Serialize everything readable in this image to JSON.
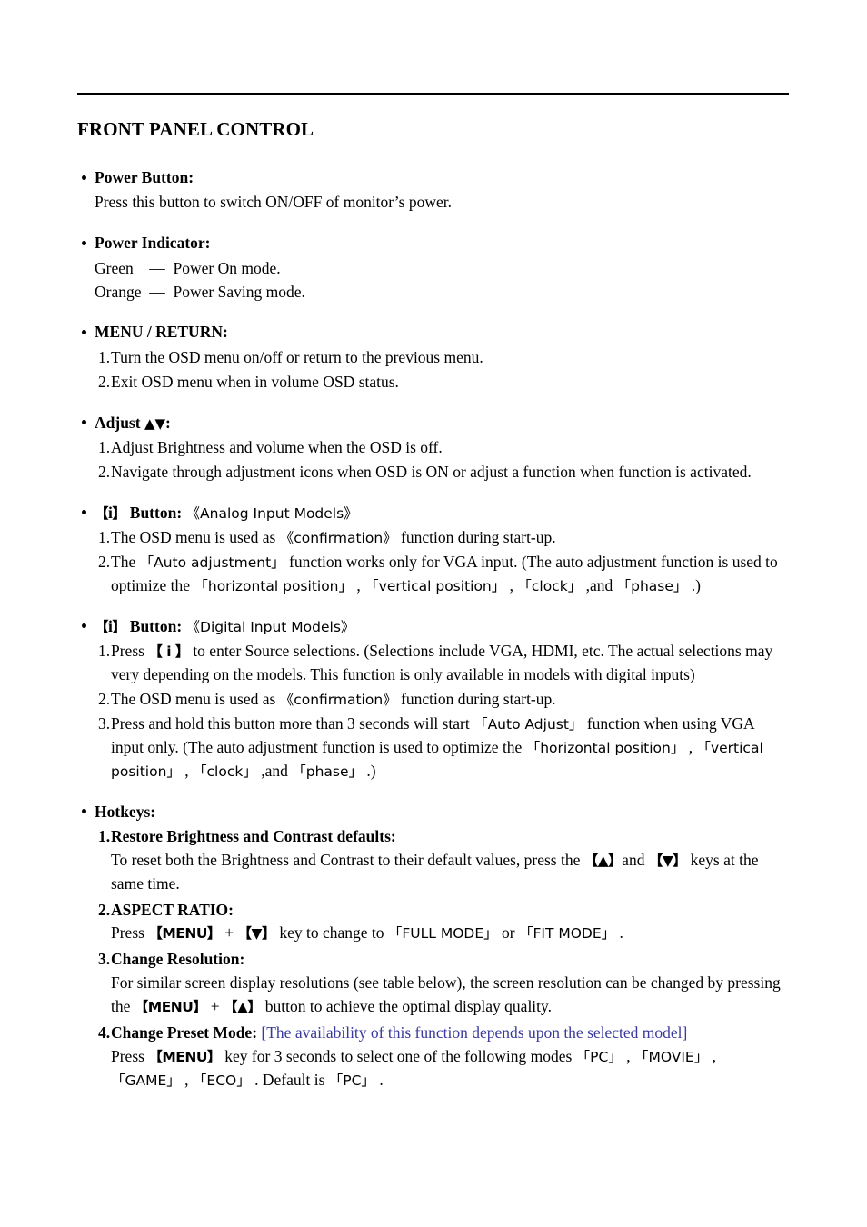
{
  "document": {
    "title": "FRONT PANEL CONTROL"
  },
  "sections": {
    "power_button": {
      "heading": "Power Button:",
      "body": "Press this button to switch ON/OFF of monitor’s power."
    },
    "power_indicator": {
      "heading": "Power Indicator:",
      "rows": [
        "Green    —  Power On mode.",
        "Orange  —  Power Saving mode."
      ]
    },
    "menu_return": {
      "heading": "MENU / RETURN:",
      "items": [
        {
          "num": "1.",
          "text": "Turn the OSD menu on/off or return to the previous menu."
        },
        {
          "num": "2.",
          "text": "Exit OSD menu when in volume OSD status."
        }
      ]
    },
    "adjust": {
      "heading_label": "Adjust",
      "heading_up": "▲",
      "heading_down": "▼",
      "heading_colon": ":",
      "items": [
        {
          "num": "1.",
          "text": "Adjust Brightness and volume when the OSD is off."
        },
        {
          "num": "2.",
          "text": "Navigate through adjustment icons when OSD is ON or adjust a function when function is activated."
        }
      ]
    },
    "i_button_analog": {
      "bracket_open": "【",
      "bracket_letter": "i",
      "bracket_close": "】",
      "heading": "Button:",
      "models": "《Analog Input Models》",
      "items": [
        {
          "num": "1.",
          "parts": [
            {
              "t": "The OSD menu is used as "
            },
            {
              "t": "《confirmation》",
              "cjk": true
            },
            {
              "t": " function during start-up."
            }
          ]
        },
        {
          "num": "2.",
          "parts": [
            {
              "t": "The "
            },
            {
              "t": "「Auto adjustment」",
              "cjk": true
            },
            {
              "t": " function works only for VGA input. (The auto adjustment function is used to optimize the "
            },
            {
              "t": "「horizontal position」",
              "cjk": true
            },
            {
              "t": " , "
            },
            {
              "t": "「vertical position」",
              "cjk": true
            },
            {
              "t": " , "
            },
            {
              "t": "「clock」",
              "cjk": true
            },
            {
              "t": " ,and "
            },
            {
              "t": "「phase」",
              "cjk": true
            },
            {
              "t": " .)"
            }
          ]
        }
      ]
    },
    "i_button_digital": {
      "bracket_open": "【",
      "bracket_letter": "i",
      "bracket_close": "】",
      "heading": "Button:",
      "models": "《Digital Input Models》",
      "items": [
        {
          "num": "1.",
          "parts": [
            {
              "t": "Press "
            },
            {
              "t": "【 i 】",
              "key": true
            },
            {
              "t": " to enter Source selections. (Selections include VGA, HDMI, etc. The actual selections may very depending on the models. This function is only available in models with digital inputs)"
            }
          ]
        },
        {
          "num": "2.",
          "parts": [
            {
              "t": "The OSD menu is used as "
            },
            {
              "t": "《confirmation》",
              "cjk": true
            },
            {
              "t": " function during start-up."
            }
          ]
        },
        {
          "num": "3.",
          "parts": [
            {
              "t": "Press and hold this button more than 3 seconds will start "
            },
            {
              "t": "「Auto Adjust」",
              "cjk": true
            },
            {
              "t": " function when using VGA input only. (The auto adjustment function is used to optimize the "
            },
            {
              "t": "「horizontal position」",
              "cjk": true
            },
            {
              "t": " , "
            },
            {
              "t": "「vertical position」",
              "cjk": true
            },
            {
              "t": " , "
            },
            {
              "t": "「clock」",
              "cjk": true
            },
            {
              "t": " ,and "
            },
            {
              "t": "「phase」",
              "cjk": true
            },
            {
              "t": " .)"
            }
          ]
        }
      ]
    },
    "hotkeys": {
      "heading": "Hotkeys:",
      "items": [
        {
          "num": "1.",
          "title": "Restore Brightness and Contrast defaults:",
          "note": "",
          "parts": [
            {
              "t": "To reset both the Brightness and Contrast to their default values, press the "
            },
            {
              "t": "【▲】",
              "key": true
            },
            {
              "t": "and "
            },
            {
              "t": "【▼】",
              "key": true
            },
            {
              "t": " keys at the same time."
            }
          ]
        },
        {
          "num": "2.",
          "title": "ASPECT RATIO:",
          "note": "",
          "parts": [
            {
              "t": "Press "
            },
            {
              "t": "【MENU】",
              "key": true
            },
            {
              "t": " + "
            },
            {
              "t": "【▼】",
              "key": true
            },
            {
              "t": " key to change to "
            },
            {
              "t": "「FULL MODE」",
              "cjk": true
            },
            {
              "t": " or "
            },
            {
              "t": "「FIT MODE」",
              "cjk": true
            },
            {
              "t": " ."
            }
          ]
        },
        {
          "num": "3.",
          "title": "Change Resolution:",
          "note": "",
          "parts": [
            {
              "t": "For similar screen display resolutions (see table below), the screen resolution can be changed by pressing the "
            },
            {
              "t": "【MENU】",
              "key": true
            },
            {
              "t": " + "
            },
            {
              "t": "【▲】",
              "key": true
            },
            {
              "t": " button to achieve the optimal display quality."
            }
          ]
        },
        {
          "num": "4.",
          "title": "Change Preset Mode:",
          "note": "[The availability of this function depends upon the selected model]",
          "parts": [
            {
              "t": "Press "
            },
            {
              "t": "【MENU】",
              "key": true
            },
            {
              "t": " key for 3 seconds to select one of the following modes "
            },
            {
              "t": "「PC」",
              "cjk": true
            },
            {
              "t": " , "
            },
            {
              "t": "「MOVIE」",
              "cjk": true
            },
            {
              "t": " , "
            },
            {
              "t": "「GAME」",
              "cjk": true
            },
            {
              "t": " , "
            },
            {
              "t": "「ECO」",
              "cjk": true
            },
            {
              "t": " . Default is "
            },
            {
              "t": "「PC」",
              "cjk": true
            },
            {
              "t": " ."
            }
          ]
        }
      ]
    }
  },
  "colors": {
    "text": "#000000",
    "note_blue": "#3a3a9c",
    "rule": "#000000"
  }
}
